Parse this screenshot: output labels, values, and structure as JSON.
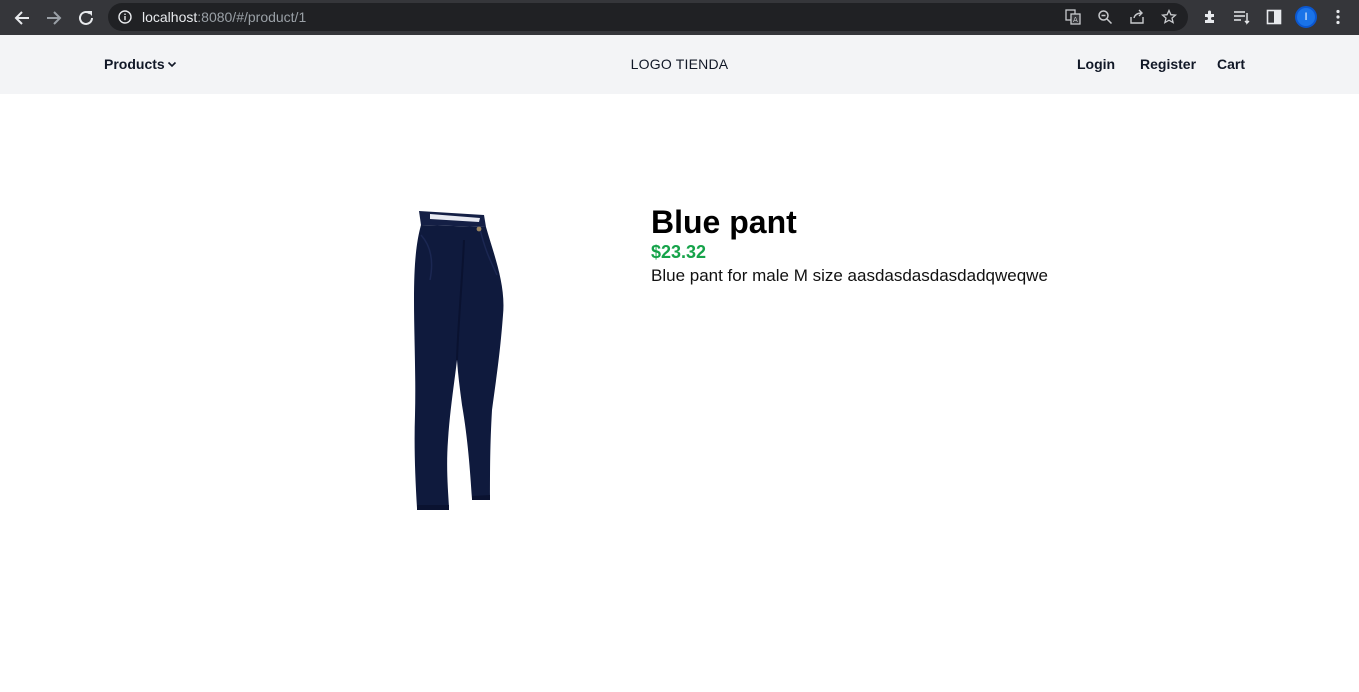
{
  "browser": {
    "url_host": "localhost",
    "url_rest": ":8080/#/product/1",
    "profile_initial": "I",
    "icons": [
      "back-icon",
      "forward-icon",
      "reload-icon",
      "info-icon",
      "translate-icon",
      "zoom-icon",
      "share-icon",
      "star-icon",
      "extensions-icon",
      "reading-list-icon",
      "side-panel-icon",
      "menu-icon"
    ]
  },
  "header": {
    "products_label": "Products",
    "logo_text": "LOGO TIENDA",
    "login_label": "Login",
    "register_label": "Register",
    "cart_label": "Cart"
  },
  "product": {
    "title": "Blue pant",
    "price": "$23.32",
    "description": "Blue pant for male M size aasdasdasdasdadqweqwe",
    "image_name": "blue-pant-image"
  },
  "colors": {
    "price": "#16a34a",
    "header_bg": "#f3f4f6",
    "pant": "#0f1a3d"
  }
}
